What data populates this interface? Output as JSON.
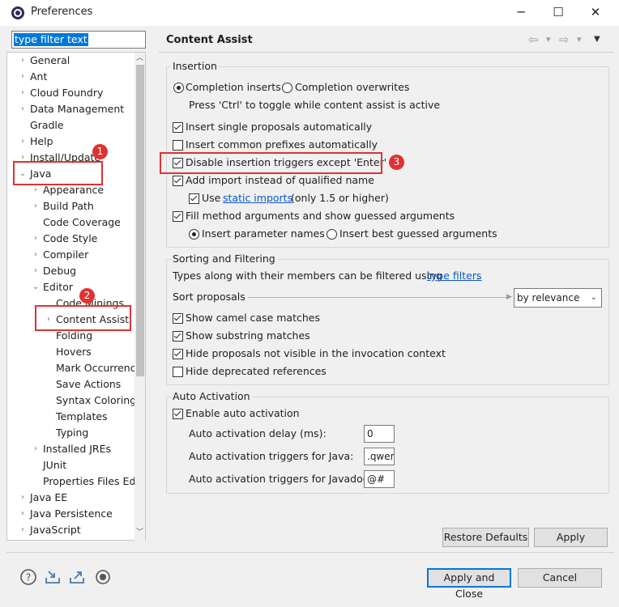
{
  "window": {
    "title": "Preferences",
    "minimize": "─",
    "maximize": "☐",
    "close": "✕"
  },
  "filter": {
    "value": "type filter text"
  },
  "tree": [
    {
      "label": "General",
      "indent": 0,
      "chev": "›"
    },
    {
      "label": "Ant",
      "indent": 0,
      "chev": "›"
    },
    {
      "label": "Cloud Foundry",
      "indent": 0,
      "chev": "›"
    },
    {
      "label": "Data Management",
      "indent": 0,
      "chev": "›"
    },
    {
      "label": "Gradle",
      "indent": 0,
      "chev": ""
    },
    {
      "label": "Help",
      "indent": 0,
      "chev": "›"
    },
    {
      "label": "Install/Update",
      "indent": 0,
      "chev": "›"
    },
    {
      "label": "Java",
      "indent": 0,
      "chev": "⌄"
    },
    {
      "label": "Appearance",
      "indent": 1,
      "chev": "›"
    },
    {
      "label": "Build Path",
      "indent": 1,
      "chev": "›"
    },
    {
      "label": "Code Coverage",
      "indent": 1,
      "chev": ""
    },
    {
      "label": "Code Style",
      "indent": 1,
      "chev": "›"
    },
    {
      "label": "Compiler",
      "indent": 1,
      "chev": "›"
    },
    {
      "label": "Debug",
      "indent": 1,
      "chev": "›"
    },
    {
      "label": "Editor",
      "indent": 1,
      "chev": "⌄"
    },
    {
      "label": "Code Minings",
      "indent": 2,
      "chev": ""
    },
    {
      "label": "Content Assist",
      "indent": 2,
      "chev": "›"
    },
    {
      "label": "Folding",
      "indent": 2,
      "chev": ""
    },
    {
      "label": "Hovers",
      "indent": 2,
      "chev": ""
    },
    {
      "label": "Mark Occurrences",
      "indent": 2,
      "chev": ""
    },
    {
      "label": "Save Actions",
      "indent": 2,
      "chev": ""
    },
    {
      "label": "Syntax Coloring",
      "indent": 2,
      "chev": ""
    },
    {
      "label": "Templates",
      "indent": 2,
      "chev": ""
    },
    {
      "label": "Typing",
      "indent": 2,
      "chev": ""
    },
    {
      "label": "Installed JREs",
      "indent": 1,
      "chev": "›"
    },
    {
      "label": "JUnit",
      "indent": 1,
      "chev": ""
    },
    {
      "label": "Properties Files Editor",
      "indent": 1,
      "chev": ""
    },
    {
      "label": "Java EE",
      "indent": 0,
      "chev": "›"
    },
    {
      "label": "Java Persistence",
      "indent": 0,
      "chev": "›"
    },
    {
      "label": "JavaScript",
      "indent": 0,
      "chev": "›"
    }
  ],
  "page": {
    "title": "Content Assist",
    "nav": {
      "back": "⇦",
      "forward": "⇨",
      "dropdown": "▾",
      "menu": "▼"
    },
    "insertion": {
      "label": "Insertion",
      "completion_inserts": "Completion inserts",
      "completion_overwrites": "Completion overwrites",
      "toggle_hint": "Press 'Ctrl' to toggle while content assist is active",
      "single_proposals": "Insert single proposals automatically",
      "common_prefixes": "Insert common prefixes automatically",
      "disable_triggers": "Disable insertion triggers except 'Enter'",
      "add_import": "Add import instead of qualified name",
      "use_label": "Use",
      "static_imports": "static imports",
      "only_15": "(only 1.5 or higher)",
      "fill_method": "Fill method arguments and show guessed arguments",
      "insert_param_names": "Insert parameter names",
      "insert_best_guessed": "Insert best guessed arguments"
    },
    "sorting": {
      "label": "Sorting and Filtering",
      "types_text": "Types along with their members can be filtered using",
      "type_filters": "type filters",
      "period": ".",
      "sort_label": "Sort proposals",
      "sort_value": "by relevance",
      "camel": "Show camel case matches",
      "substring": "Show substring matches",
      "hide_not_visible": "Hide proposals not visible in the invocation context",
      "hide_deprecated": "Hide deprecated references"
    },
    "auto": {
      "label": "Auto Activation",
      "enable": "Enable auto activation",
      "delay_label": "Auto activation delay (ms):",
      "delay_value": "0",
      "java_label": "Auto activation triggers for Java:",
      "java_value": ".qwer",
      "javadoc_label": "Auto activation triggers for Javadoc:",
      "javadoc_value": "@#"
    },
    "restore_defaults": "Restore Defaults",
    "apply": "Apply"
  },
  "footer": {
    "apply_close": "Apply and Close",
    "cancel": "Cancel"
  },
  "annotations": {
    "badge1": "1",
    "badge2": "2",
    "badge3": "3"
  },
  "colors": {
    "annotation_red": "#e03232",
    "selection": "#0078d7",
    "link": "#0a58ca"
  }
}
